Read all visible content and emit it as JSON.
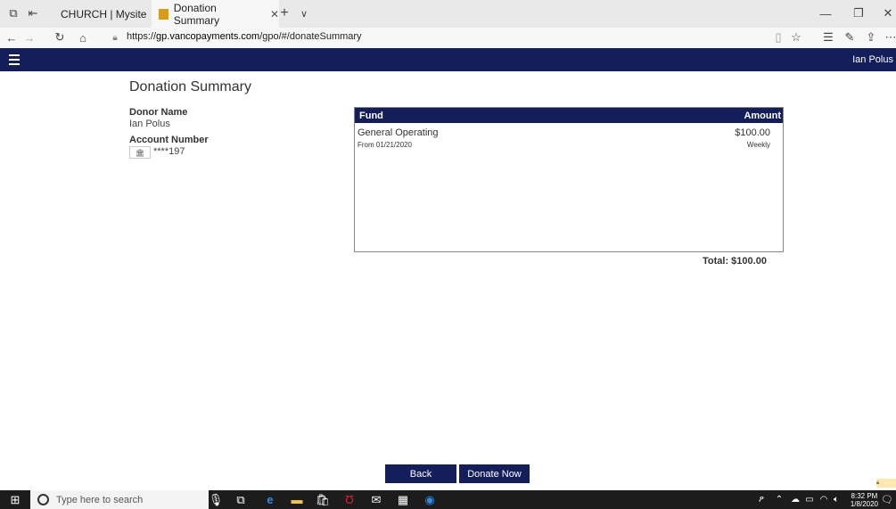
{
  "browser": {
    "tabs": [
      {
        "label": "CHURCH | Mysite"
      },
      {
        "label": "Donation Summary"
      }
    ],
    "new_tab": "+",
    "tab_dropdown": "∨",
    "url_prefix": "https://",
    "url_host": "gp.vancopayments.com",
    "url_path": "/gpo/#/donateSummary",
    "window_controls": {
      "minimize": "—",
      "restore": "❐",
      "close": "✕"
    }
  },
  "app": {
    "user_name": "Ian Polus"
  },
  "page": {
    "title": "Donation Summary",
    "donor_name_label": "Donor Name",
    "donor_name": "Ian Polus",
    "account_number_label": "Account Number",
    "account_number": "****197"
  },
  "fund_table": {
    "headers": {
      "fund": "Fund",
      "amount": "Amount"
    },
    "rows": [
      {
        "fund": "General Operating",
        "amount": "$100.00",
        "from": "From 01/21/2020",
        "frequency": "Weekly"
      }
    ],
    "total": "Total: $100.00"
  },
  "actions": {
    "back": "Back",
    "donate_now": "Donate Now"
  },
  "taskbar": {
    "search_placeholder": "Type here to search",
    "time": "8:32 PM",
    "date": "1/8/2020"
  },
  "colors": {
    "brand_navy": "#141e5a"
  }
}
